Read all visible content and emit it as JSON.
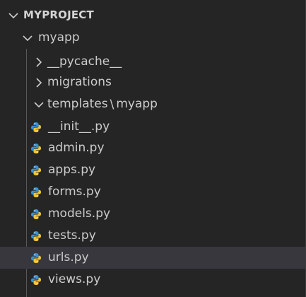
{
  "explorer": {
    "project": {
      "label": "MYPROJECT",
      "expanded": true
    },
    "app_folder": {
      "label": "myapp",
      "expanded": true
    },
    "folders": [
      {
        "label": "__pycache__",
        "expanded": false
      },
      {
        "label": "migrations",
        "expanded": false
      }
    ],
    "templates_folder": {
      "label_part1": "templates",
      "separator": "\\",
      "label_part2": "myapp",
      "expanded": true
    },
    "files": [
      {
        "label": "__init__.py",
        "icon": "python-icon"
      },
      {
        "label": "admin.py",
        "icon": "python-icon"
      },
      {
        "label": "apps.py",
        "icon": "python-icon"
      },
      {
        "label": "forms.py",
        "icon": "python-icon"
      },
      {
        "label": "models.py",
        "icon": "python-icon"
      },
      {
        "label": "tests.py",
        "icon": "python-icon"
      },
      {
        "label": "urls.py",
        "icon": "python-icon",
        "selected": true
      },
      {
        "label": "views.py",
        "icon": "python-icon"
      }
    ],
    "colors": {
      "background": "#252526",
      "selected_row": "#37373d",
      "python_blue": "#3b8fd6",
      "python_yellow": "#f4c430",
      "text": "#cccccc"
    }
  }
}
